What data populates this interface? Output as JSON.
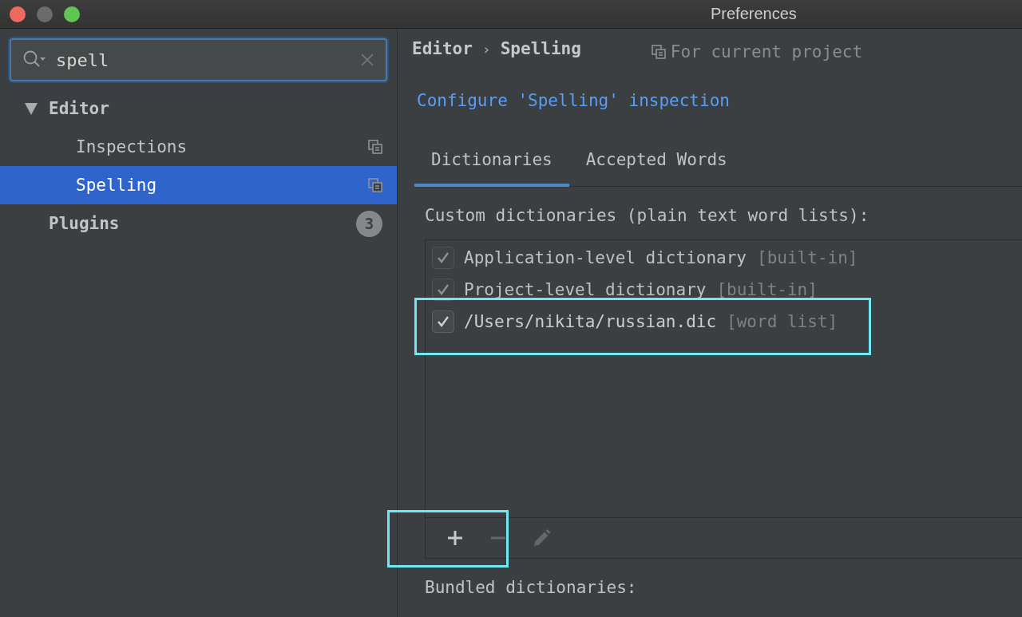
{
  "window": {
    "title": "Preferences"
  },
  "search": {
    "value": "spell"
  },
  "sidebar": {
    "items": [
      {
        "label": "Editor",
        "expanded": true,
        "selected": false,
        "children": [
          {
            "label": "Inspections",
            "selected": false,
            "project_icon": true
          },
          {
            "label": "Spelling",
            "selected": true,
            "project_icon": true
          }
        ]
      },
      {
        "label": "Plugins",
        "selected": false,
        "badge": "3"
      }
    ]
  },
  "breadcrumb": [
    "Editor",
    "›",
    "Spelling"
  ],
  "scope_note": "For current project",
  "link": "Configure 'Spelling' inspection",
  "tabs": [
    {
      "label": "Dictionaries",
      "selected": true
    },
    {
      "label": "Accepted Words",
      "selected": false
    }
  ],
  "custom_label": "Custom dictionaries (plain text word lists):",
  "dictionaries": [
    {
      "name": "Application-level dictionary",
      "tag": "[built-in]",
      "checked": true,
      "disabled": true,
      "highlighted": false
    },
    {
      "name": "Project-level dictionary",
      "tag": "[built-in]",
      "checked": true,
      "disabled": true,
      "highlighted": false
    },
    {
      "name": "/Users/nikita/russian.dic",
      "tag": "[word list]",
      "checked": true,
      "disabled": false,
      "highlighted": true
    }
  ],
  "toolbar": {
    "highlighted": true,
    "buttons": [
      {
        "kind": "add",
        "disabled": false
      },
      {
        "kind": "remove",
        "disabled": true
      },
      {
        "kind": "edit",
        "disabled": true
      }
    ]
  },
  "bundled_label": "Bundled dictionaries:"
}
